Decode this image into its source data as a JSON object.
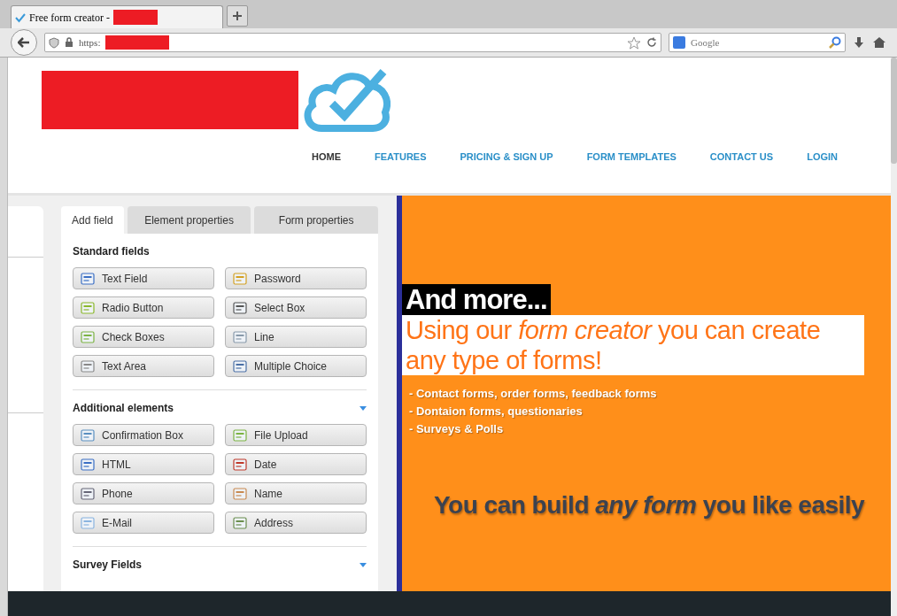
{
  "browser": {
    "tab_title": "Free form creator -",
    "url": "https:",
    "search_placeholder": "Google"
  },
  "nav": [
    {
      "label": "HOME",
      "selected": true
    },
    {
      "label": "FEATURES",
      "selected": false
    },
    {
      "label": "PRICING & SIGN UP",
      "selected": false
    },
    {
      "label": "FORM TEMPLATES",
      "selected": false
    },
    {
      "label": "CONTACT US",
      "selected": false
    },
    {
      "label": "LOGIN",
      "selected": false
    }
  ],
  "tabs": [
    {
      "label": "Add field",
      "selected": true
    },
    {
      "label": "Element properties",
      "selected": false
    },
    {
      "label": "Form properties",
      "selected": false
    }
  ],
  "sections": [
    {
      "title": "Standard fields",
      "collapsible": false,
      "fields": [
        "Text Field",
        "Password",
        "Radio Button",
        "Select Box",
        "Check Boxes",
        "Line",
        "Text Area",
        "Multiple Choice"
      ]
    },
    {
      "title": "Additional elements",
      "collapsible": true,
      "fields": [
        "Confirmation Box",
        "File Upload",
        "HTML",
        "Date",
        "Phone",
        "Name",
        "E-Mail",
        "Address"
      ]
    },
    {
      "title": "Survey Fields",
      "collapsible": true
    }
  ],
  "promo": {
    "heading": "And more...",
    "subheading": "Using our *form creator* you can create any type of forms!",
    "bullets": [
      "- Contact forms, order forms, feedback forms",
      "- Dontaion forms, questionaries",
      "- Surveys & Polls"
    ],
    "tagline": "You can build *any form* you like easily"
  }
}
